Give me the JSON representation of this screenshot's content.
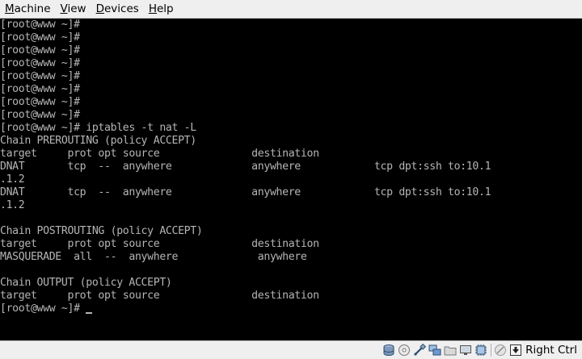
{
  "menubar": {
    "items": [
      {
        "mnemonic": "M",
        "rest": "achine"
      },
      {
        "mnemonic": "V",
        "rest": "iew"
      },
      {
        "mnemonic": "D",
        "rest": "evices"
      },
      {
        "mnemonic": "H",
        "rest": "elp"
      }
    ]
  },
  "terminal": {
    "lines": [
      "[root@www ~]#",
      "[root@www ~]#",
      "[root@www ~]#",
      "[root@www ~]#",
      "[root@www ~]#",
      "[root@www ~]#",
      "[root@www ~]#",
      "[root@www ~]#",
      "[root@www ~]# iptables -t nat -L",
      "Chain PREROUTING (policy ACCEPT)",
      "target     prot opt source               destination",
      "DNAT       tcp  --  anywhere             anywhere            tcp dpt:ssh to:10.1",
      ".1.2",
      "DNAT       tcp  --  anywhere             anywhere            tcp dpt:ssh to:10.1",
      ".1.2",
      "",
      "Chain POSTROUTING (policy ACCEPT)",
      "target     prot opt source               destination",
      "MASQUERADE  all  --  anywhere             anywhere",
      "",
      "Chain OUTPUT (policy ACCEPT)",
      "target     prot opt source               destination"
    ],
    "prompt": "[root@www ~]# "
  },
  "statusbar": {
    "icons": [
      "hard-disk-icon",
      "optical-disk-icon",
      "usb-icon",
      "network-icon",
      "shared-folders-icon",
      "display-icon",
      "cpu-icon",
      "mouse-integration-icon",
      "host-key-arrow-icon"
    ],
    "host_key": "Right Ctrl"
  }
}
